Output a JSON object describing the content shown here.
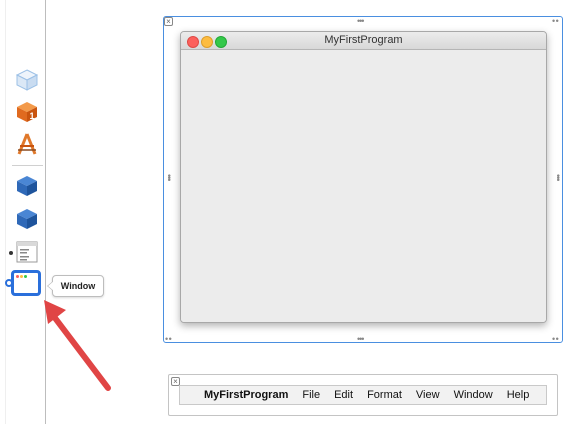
{
  "tooltip": {
    "text": "Window"
  },
  "outline_icons": [
    {
      "name": "ghost-cube-icon"
    },
    {
      "name": "orange-cube-icon",
      "badge": "1"
    },
    {
      "name": "app-icon"
    },
    {
      "name": "blue-cube-icon"
    },
    {
      "name": "blue-cube-icon"
    },
    {
      "name": "menu-icon"
    },
    {
      "name": "window-icon"
    }
  ],
  "window": {
    "title": "MyFirstProgram"
  },
  "menubar": {
    "app": "MyFirstProgram",
    "items": [
      "File",
      "Edit",
      "Format",
      "View",
      "Window",
      "Help"
    ]
  },
  "colors": {
    "selection": "#2a6fdb",
    "arrow": "#e04545",
    "traffic_red": "#fc605c",
    "traffic_yellow": "#fdbc40",
    "traffic_green": "#34c84a"
  }
}
